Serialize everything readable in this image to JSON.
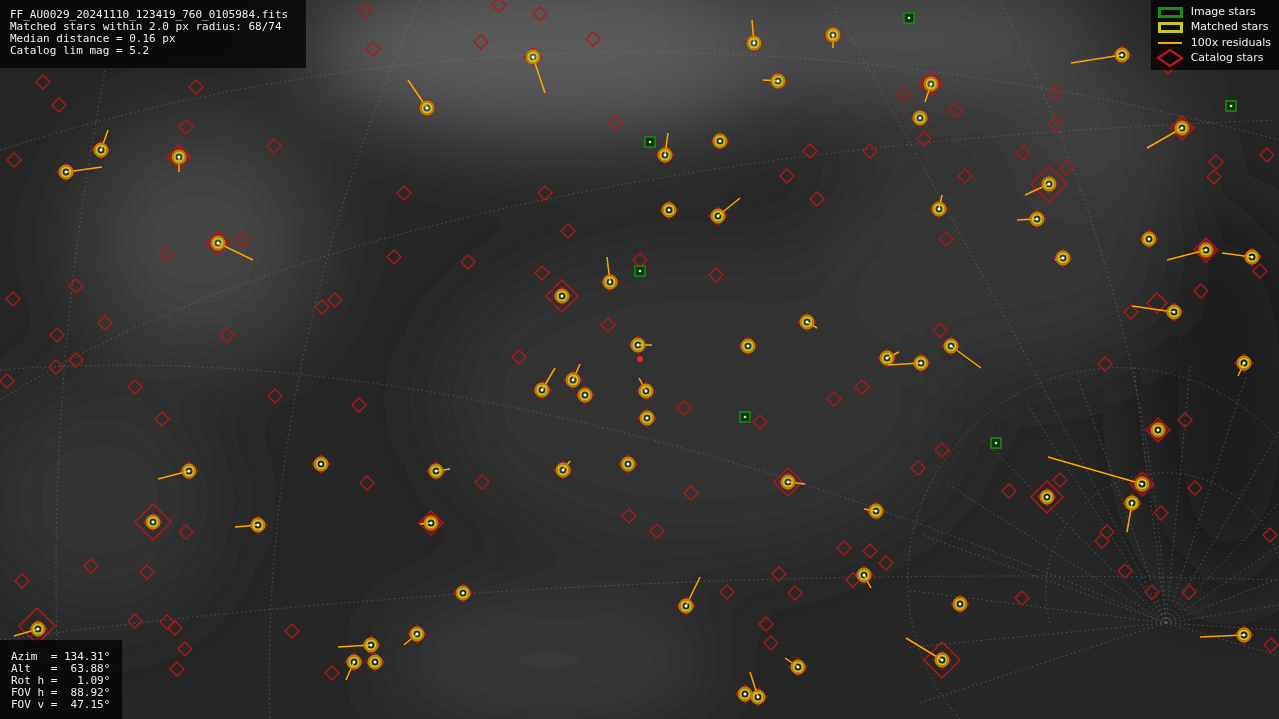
{
  "info": {
    "lines": [
      "FF_AU0029_20241110_123419_760_0105984.fits",
      "Matched stars within 2.0 px radius: 68/74",
      "Median distance = 0.16 px",
      "Catalog lim mag = 5.2"
    ]
  },
  "legend": [
    {
      "label": "Image stars",
      "color": "#1a8a1a"
    },
    {
      "kind": "matched",
      "label": "Matched stars",
      "color": "#c8c81e"
    },
    {
      "kind": "residual",
      "label": "100x residuals",
      "color": "#ffa500"
    },
    {
      "kind": "catalog",
      "label": "Catalog stars",
      "color": "#b01818"
    }
  ],
  "pointing": {
    "lines": [
      "Azim  = 134.31°",
      "Alt   =  63.88°",
      "Rot h =   1.09°",
      "FOV h =  88.92°",
      "FOV v =  47.15°"
    ]
  }
}
